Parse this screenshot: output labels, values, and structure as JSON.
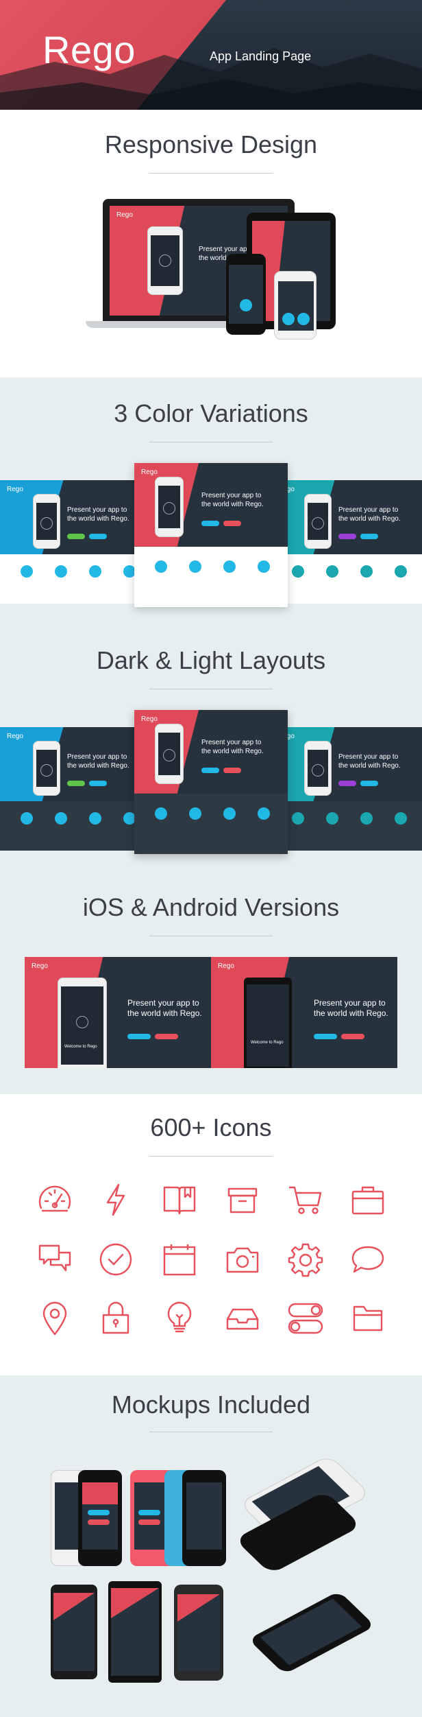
{
  "hero": {
    "logo": "Rego",
    "tagline": "App Landing Page"
  },
  "sections": {
    "responsive": {
      "title": "Responsive Design"
    },
    "colors": {
      "title": "3 Color Variations"
    },
    "layouts": {
      "title": "Dark & Light Layouts"
    },
    "platforms": {
      "title": "iOS & Android Versions"
    },
    "icons": {
      "title": "600+ Icons"
    },
    "mockups": {
      "title": "Mockups Included"
    }
  },
  "mini": {
    "logo": "Rego",
    "headline_1": "Present your app to",
    "headline_2": "the world with Rego.",
    "welcome": "Welcome to Rego"
  },
  "colors": {
    "red": "#e04a58",
    "teal": "#1ba7b0",
    "blue": "#1aa0d8",
    "cyan": "#22b8e6",
    "dark": "#26323e",
    "icon_stroke": "#e8505b"
  },
  "icon_names": [
    "speedometer-icon",
    "lightning-icon",
    "book-icon",
    "archive-box-icon",
    "cart-icon",
    "briefcase-icon",
    "chat-bubbles-icon",
    "check-circle-icon",
    "calendar-icon",
    "camera-icon",
    "gear-icon",
    "speech-bubble-icon",
    "map-pin-icon",
    "lock-icon",
    "lightbulb-icon",
    "inbox-tray-icon",
    "toggle-switches-icon",
    "folder-icon"
  ]
}
